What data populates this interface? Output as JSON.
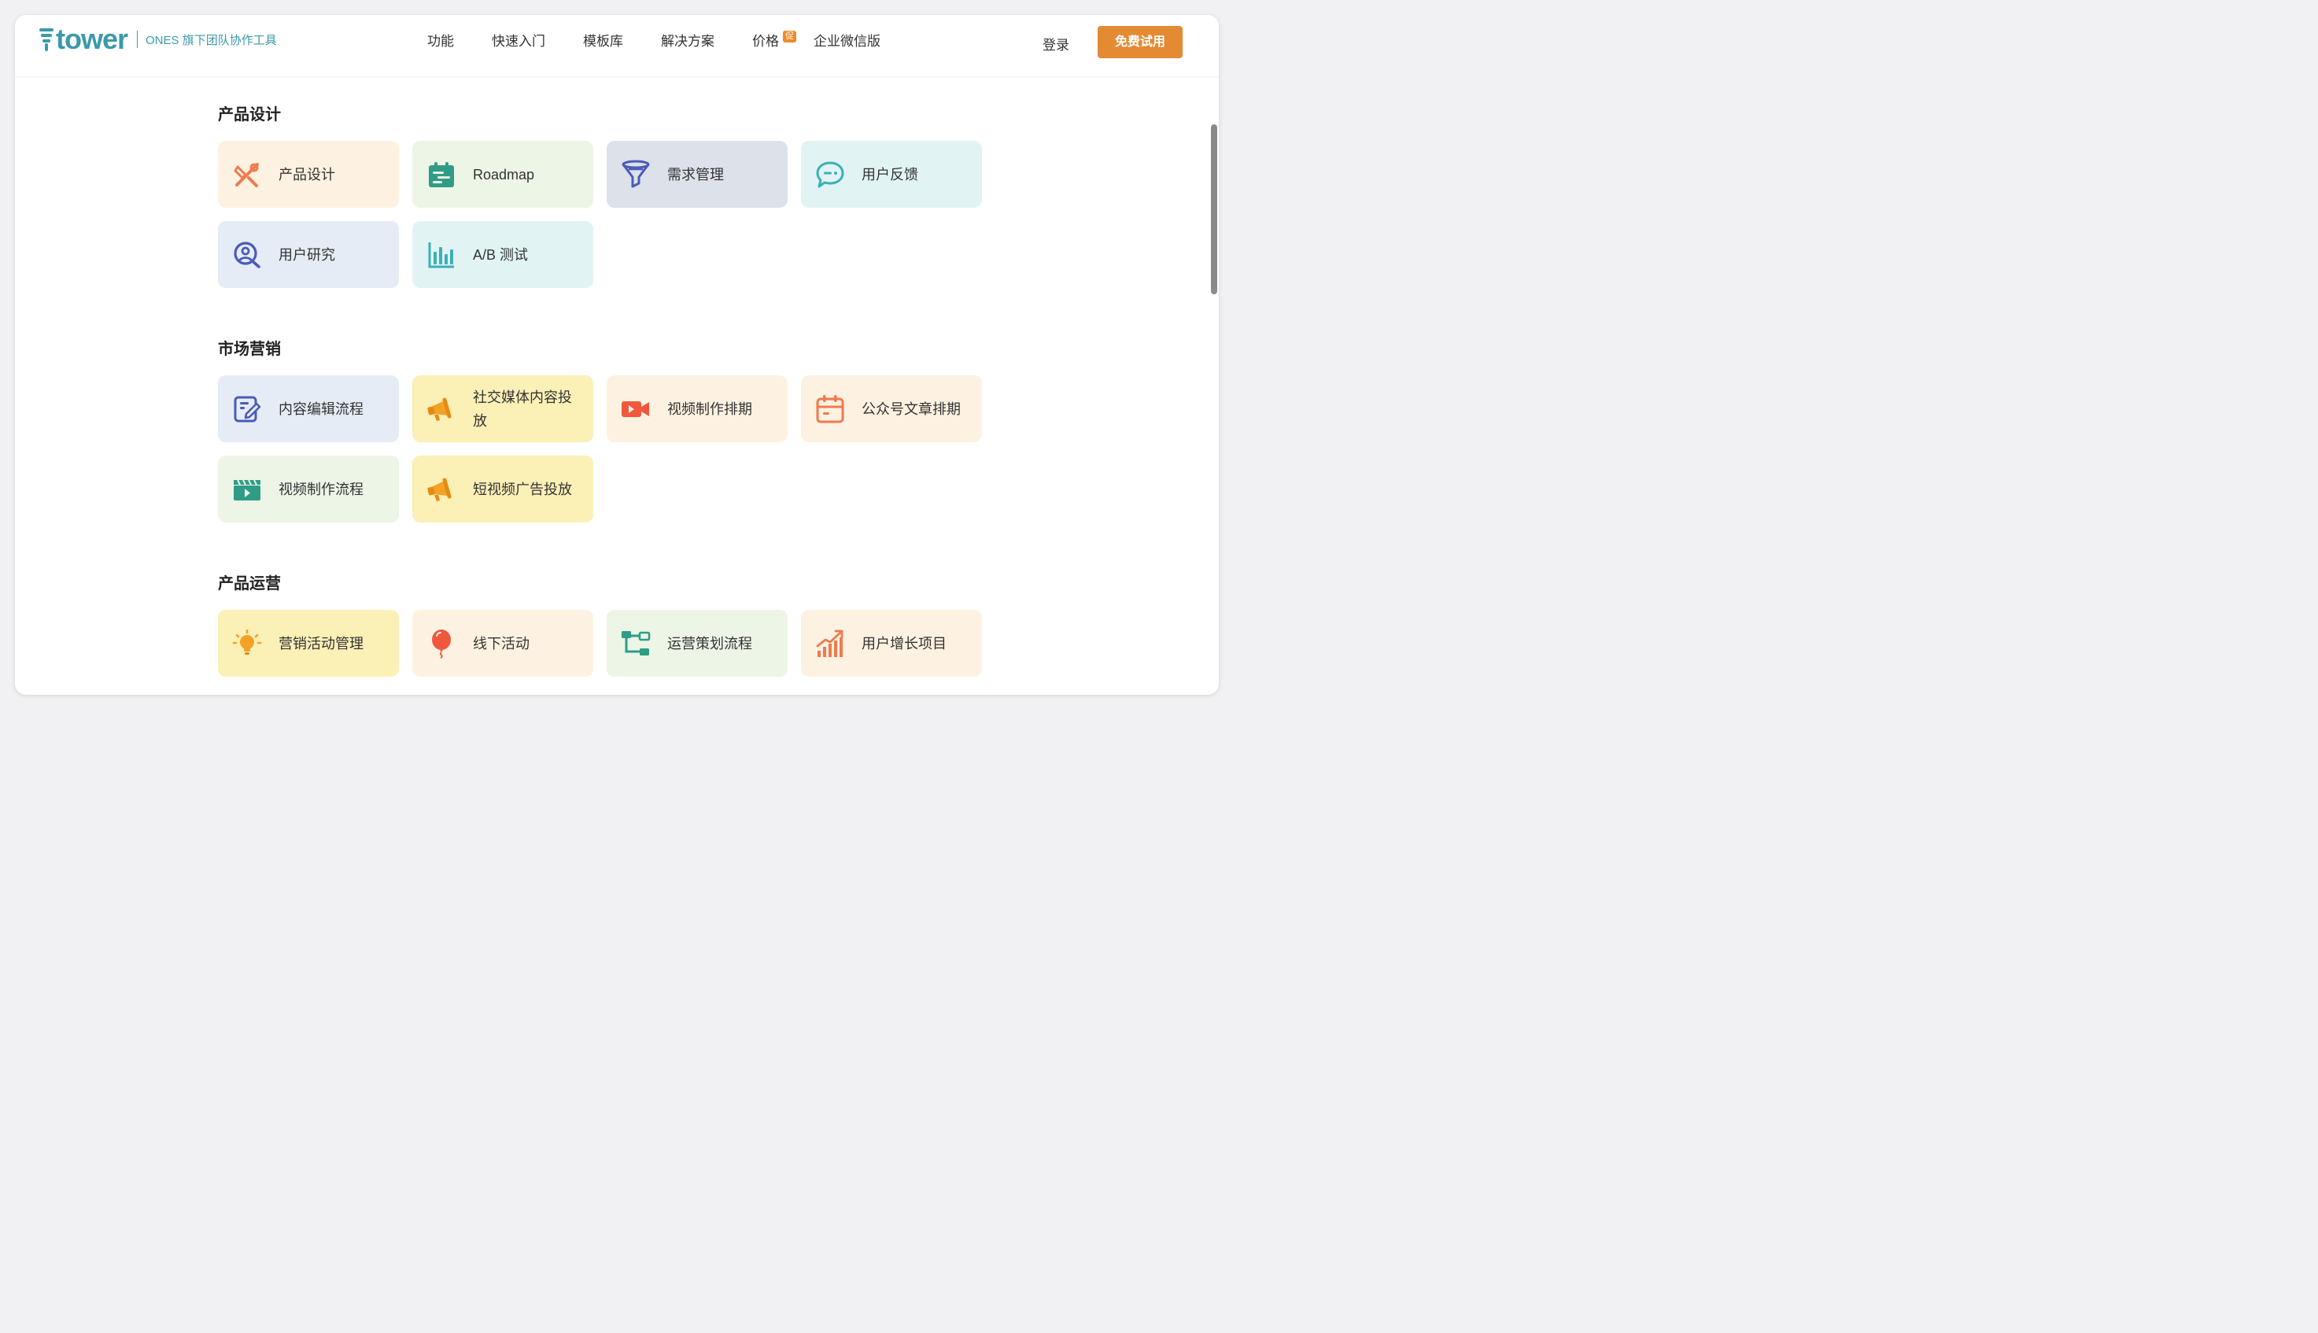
{
  "header": {
    "logo_text": "tower",
    "logo_sub": "ONES 旗下团队协作工具",
    "nav": [
      {
        "label": "功能"
      },
      {
        "label": "快速入门"
      },
      {
        "label": "模板库"
      },
      {
        "label": "解决方案"
      },
      {
        "label": "价格",
        "badge": "促"
      },
      {
        "label": "企业微信版"
      }
    ],
    "login": "登录",
    "cta": "免费试用"
  },
  "sections": [
    {
      "title": "产品设计",
      "cards": [
        {
          "label": "产品设计",
          "icon": "design-tools-icon",
          "color": "#fdf2e1"
        },
        {
          "label": "Roadmap",
          "icon": "calendar-list-icon",
          "color": "#edf5e6"
        },
        {
          "label": "需求管理",
          "icon": "funnel-icon",
          "color": "#dce1ea"
        },
        {
          "label": "用户反馈",
          "icon": "chat-bubble-icon",
          "color": "#e2f3f4"
        },
        {
          "label": "用户研究",
          "icon": "user-search-icon",
          "color": "#e5ecf5"
        },
        {
          "label": "A/B 测试",
          "icon": "bar-chart-icon",
          "color": "#e2f3f4"
        }
      ]
    },
    {
      "title": "市场营销",
      "cards": [
        {
          "label": "内容编辑流程",
          "icon": "edit-document-icon",
          "color": "#e5ecf5"
        },
        {
          "label": "社交媒体内容投放",
          "icon": "megaphone-icon",
          "color": "#fbf0b6"
        },
        {
          "label": "视频制作排期",
          "icon": "video-camera-icon",
          "color": "#fdf2e1"
        },
        {
          "label": "公众号文章排期",
          "icon": "calendar-icon",
          "color": "#fdf2e1"
        },
        {
          "label": "视频制作流程",
          "icon": "clapperboard-icon",
          "color": "#edf5e6"
        },
        {
          "label": "短视频广告投放",
          "icon": "megaphone-icon",
          "color": "#fbf0b6"
        }
      ]
    },
    {
      "title": "产品运营",
      "cards": [
        {
          "label": "营销活动管理",
          "icon": "lightbulb-icon",
          "color": "#fbf0b6"
        },
        {
          "label": "线下活动",
          "icon": "balloon-icon",
          "color": "#fdf2e1"
        },
        {
          "label": "运营策划流程",
          "icon": "flow-tree-icon",
          "color": "#edf5e6"
        },
        {
          "label": "用户增长项目",
          "icon": "growth-chart-icon",
          "color": "#fdf2e1"
        }
      ]
    }
  ]
}
